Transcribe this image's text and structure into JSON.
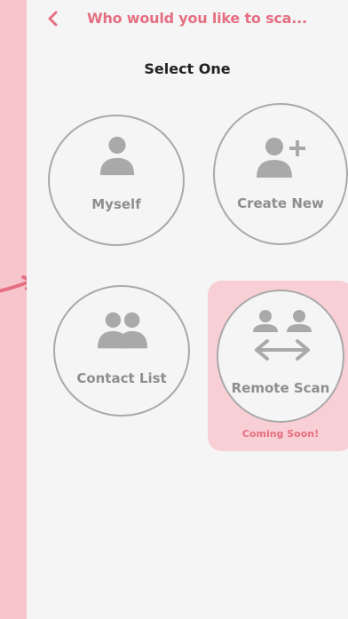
{
  "header": {
    "title": "Who would you like to sca...",
    "back_icon": "chevron-left-icon"
  },
  "subtitle": "Select One",
  "options": [
    {
      "label": "Myself",
      "icon": "user-icon"
    },
    {
      "label": "Create New",
      "icon": "user-plus-icon"
    },
    {
      "label": "Contact List",
      "icon": "users-icon"
    },
    {
      "label": "Remote Scan",
      "icon": "users-exchange-icon",
      "badge": "Coming Soon!"
    }
  ],
  "colors": {
    "accent": "#e56f82",
    "accent_light": "#f8cfd4",
    "side_strip": "#f7c6cc",
    "icon_gray": "#a9a9a9",
    "background": "#f5f5f5"
  },
  "decor": {
    "hint_arrow_icon": "curved-arrow-icon"
  }
}
